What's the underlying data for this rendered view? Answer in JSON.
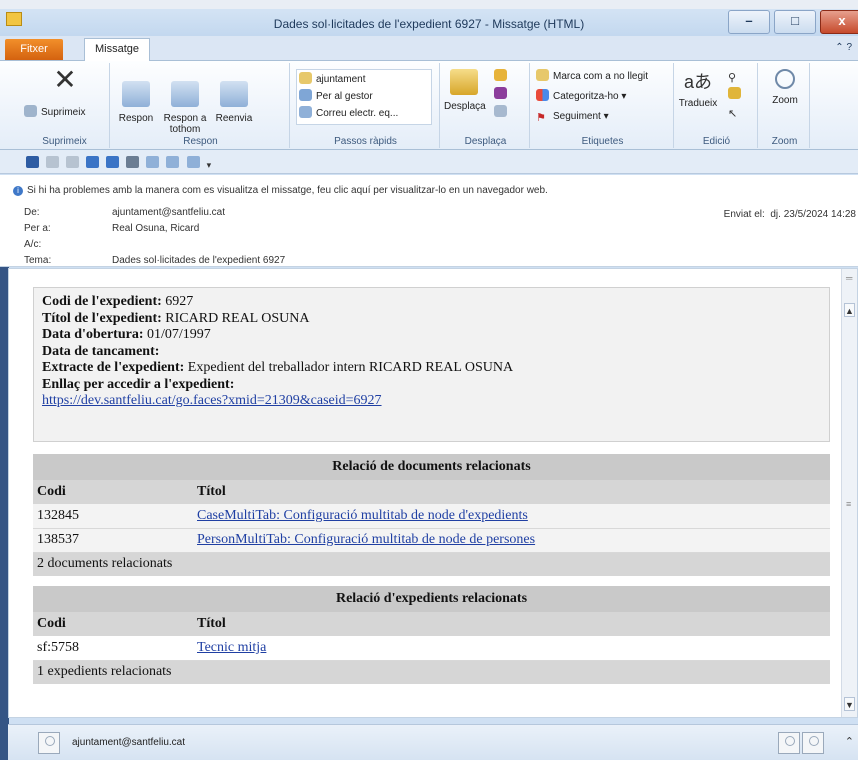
{
  "window": {
    "title": "Dades sol·licitades de l'expedient 6927  -  Missatge (HTML)",
    "minimize": "–",
    "maximize": "□",
    "close": "x"
  },
  "tabs": {
    "file": "Fitxer",
    "message": "Missatge",
    "right_icons": "⌃ ?"
  },
  "ribbon": {
    "delete_group": {
      "label": "Suprimeix",
      "delete": "Suprimeix"
    },
    "respond_group": {
      "label": "Respon",
      "reply": "Respon",
      "reply_all": "Respon a tothom",
      "forward": "Reenvia"
    },
    "quick_steps": {
      "label": "Passos ràpids",
      "items": [
        "ajuntament",
        "Per al gestor",
        "Correu electr. eq..."
      ]
    },
    "move_group": {
      "label": "Desplaça",
      "move": "Desplaça"
    },
    "tags_group": {
      "label": "Etiquetes",
      "items": [
        "Marca com a no llegit",
        "Categoritza-ho ▾",
        "Seguiment ▾"
      ]
    },
    "edit_group": {
      "label": "Edició",
      "translate": "Tradueix"
    },
    "zoom_group": {
      "label": "Zoom",
      "zoom": "Zoom"
    }
  },
  "header": {
    "info": "Si hi ha problemes amb la manera com es visualitza el missatge, feu clic aquí per visualitzar-lo en un navegador web.",
    "from_label": "De:",
    "from": "ajuntament@santfeliu.cat",
    "to_label": "Per a:",
    "to": "Real Osuna, Ricard",
    "cc_label": "A/c:",
    "cc": "",
    "subject_label": "Tema:",
    "subject": "Dades sol·licitades de l'expedient 6927",
    "sent_label": "Enviat el:",
    "sent": "dj. 23/5/2024 14:28"
  },
  "summary": {
    "code_label": "Codi de l'expedient:",
    "code": " 6927",
    "title_label": "Títol de l'expedient:",
    "title": " RICARD REAL OSUNA",
    "open_label": "Data d'obertura:",
    "open": " 01/07/1997",
    "close_label": "Data de tancament:",
    "close": "",
    "extract_label": "Extracte de l'expedient:",
    "extract": " Expedient del treballador intern RICARD REAL OSUNA",
    "link_label": "Enllaç per accedir a l'expedient:",
    "link": "https://dev.santfeliu.cat/go.faces?xmid=21309&caseid=6927"
  },
  "documents": {
    "heading": "Relació de documents relacionats",
    "col_code": "Codi",
    "col_title": "Títol",
    "rows": [
      {
        "code": "132845",
        "title": "CaseMultiTab: Configuració multitab de node d'expedients"
      },
      {
        "code": "138537",
        "title": "PersonMultiTab: Configuració multitab de node de persones"
      }
    ],
    "footer": "2 documents relacionats"
  },
  "cases": {
    "heading": "Relació d'expedients relacionats",
    "col_code": "Codi",
    "col_title": "Títol",
    "rows": [
      {
        "code": "sf:5758",
        "title": "Tecnic mitja"
      }
    ],
    "footer": "1 expedients relacionats"
  },
  "statusbar": {
    "sender": "ajuntament@santfeliu.cat"
  }
}
